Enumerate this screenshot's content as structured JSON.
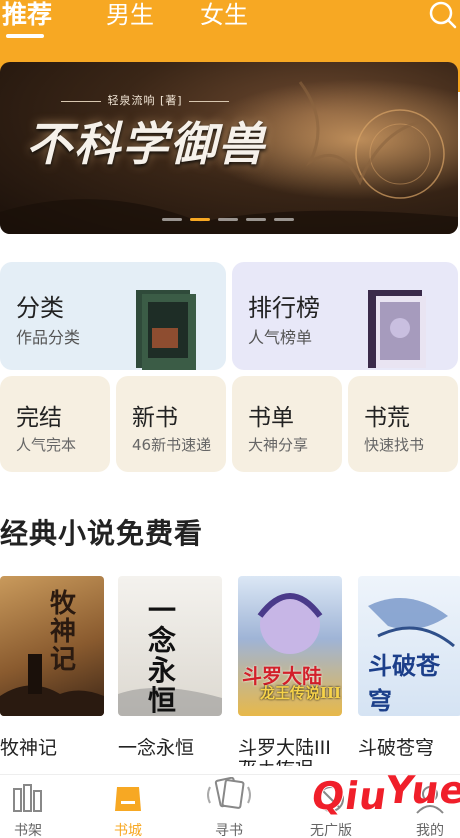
{
  "header": {
    "tabs": [
      {
        "label": "推荐",
        "active": true
      },
      {
        "label": "男生",
        "active": false
      },
      {
        "label": "女生",
        "active": false
      }
    ],
    "search_icon": "search-icon",
    "background_color": "#f7a823"
  },
  "banner": {
    "author_line": "轻泉流响 [著]",
    "title": "不科学御兽",
    "page_count": 5,
    "active_index": 1
  },
  "categories": [
    {
      "title": "分类",
      "subtitle": "作品分类"
    },
    {
      "title": "排行榜",
      "subtitle": "人气榜单"
    }
  ],
  "quick_links": [
    {
      "title": "完结",
      "subtitle": "人气完本"
    },
    {
      "title": "新书",
      "subtitle": "46新书速递"
    },
    {
      "title": "书单",
      "subtitle": "大神分享"
    },
    {
      "title": "书荒",
      "subtitle": "快速找书"
    }
  ],
  "section": {
    "title": "经典小说免费看",
    "books": [
      {
        "name": "牧神记",
        "cover_text": "牧神记"
      },
      {
        "name": "一念永恒",
        "cover_text": "一念永恒"
      },
      {
        "name": "斗罗大陆III",
        "name_line2": "龙王传说",
        "cover_text": "斗罗大陆",
        "cover_subtext": "龙王传说III"
      },
      {
        "name": "斗破苍穹",
        "cover_text": "斗破苍穹"
      }
    ]
  },
  "bottom_nav": [
    {
      "label": "书架",
      "icon": "bookshelf-icon",
      "active": false
    },
    {
      "label": "书城",
      "icon": "bookstore-icon",
      "active": true
    },
    {
      "label": "寻书",
      "icon": "find-book-icon",
      "active": false
    },
    {
      "label": "无广版",
      "icon": "no-ads-icon",
      "active": false
    },
    {
      "label": "我的",
      "icon": "profile-icon",
      "active": false
    }
  ],
  "watermark": {
    "text": "Qiu",
    "text2": "Yue"
  },
  "accent_color": "#f7a823"
}
